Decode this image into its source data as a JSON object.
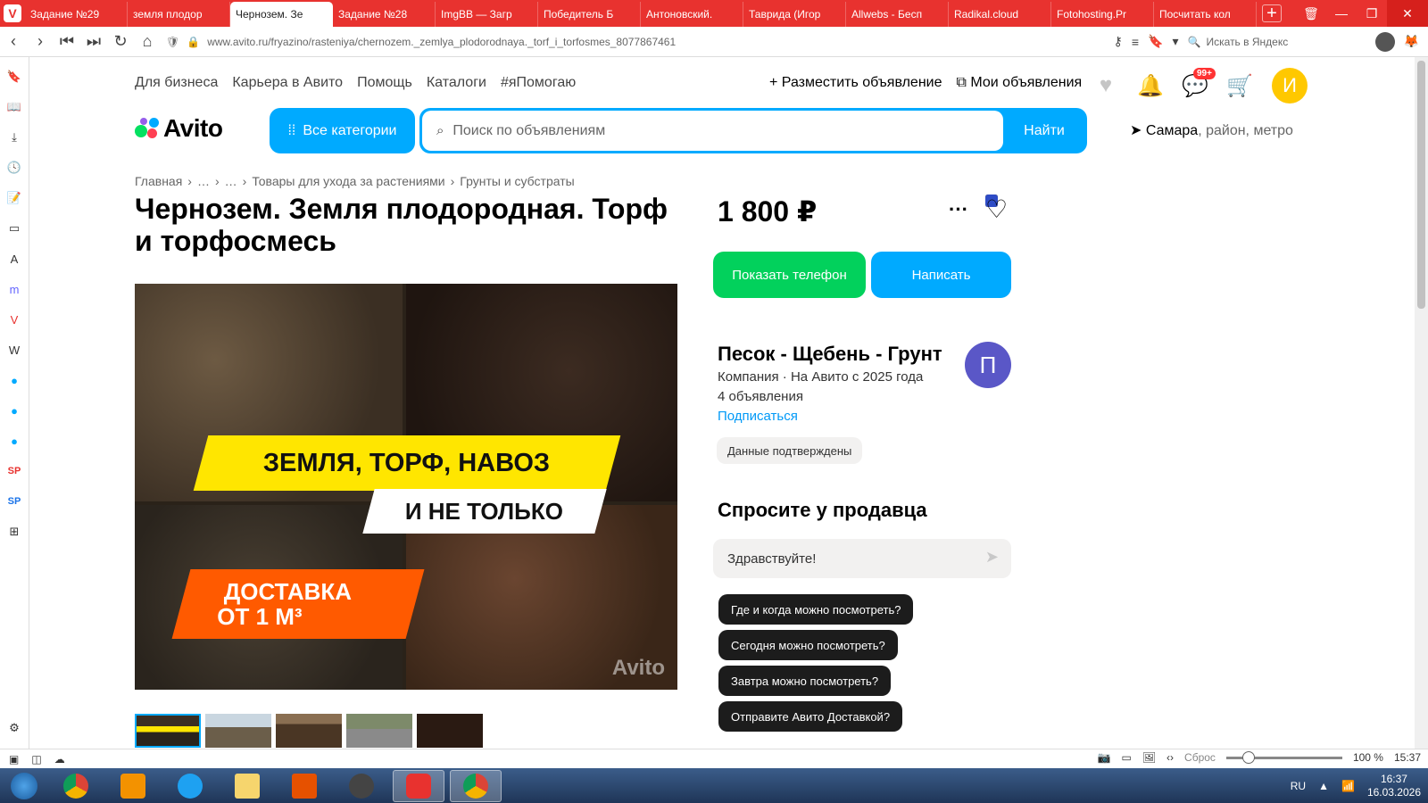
{
  "browser": {
    "tabs": [
      {
        "title": "Задание №29",
        "favicon_color": "#e8322f",
        "favicon_text": "SP"
      },
      {
        "title": "земля плодор",
        "favicon_color": "#ffffff",
        "favicon_text": ""
      },
      {
        "title": "Чернозем. Зе",
        "favicon_color": "#00aaff",
        "favicon_text": "",
        "active": true
      },
      {
        "title": "Задание №28",
        "favicon_color": "#e8322f",
        "favicon_text": "SP"
      },
      {
        "title": "ImgBB — Загр",
        "favicon_color": "#2a7ae2",
        "favicon_text": "ibb"
      },
      {
        "title": "Победитель Б",
        "favicon_color": "#0077ff",
        "favicon_text": "VK"
      },
      {
        "title": "Антоновский.",
        "favicon_color": "#7a3d8f",
        "favicon_text": "LIB"
      },
      {
        "title": "Таврида (Игор",
        "favicon_color": "#3fae49",
        "favicon_text": ""
      },
      {
        "title": "Allwebs - Бесп",
        "favicon_color": "#1aa3c8",
        "favicon_text": ""
      },
      {
        "title": "Radikal.cloud",
        "favicon_color": "#111111",
        "favicon_text": "R"
      },
      {
        "title": "Fotohosting.Pr",
        "favicon_color": "#f5a623",
        "favicon_text": "F"
      },
      {
        "title": "Посчитать кол",
        "favicon_color": "#2e4cc6",
        "favicon_text": ""
      }
    ],
    "url": "www.avito.ru/fryazino/rasteniya/chernozem._zemlya_plodorodnaya._torf_i_torfosmes_8077867461",
    "yandex_placeholder": "Искать в Яндекс",
    "accent": "#e8322f"
  },
  "header": {
    "nav": [
      "Для бизнеса",
      "Карьера в Авито",
      "Помощь",
      "Каталоги",
      "#яПомогаю"
    ],
    "post_ad": "Разместить объявление",
    "my_ads": "Мои объявления",
    "messages_badge": "99+",
    "user_initial": "И",
    "logo": "Avito",
    "all_categories": "Все категории",
    "search_placeholder": "Поиск по объявлениям",
    "search_button": "Найти",
    "location_city": "Самара",
    "location_rest": ", район, метро"
  },
  "breadcrumbs": [
    "Главная",
    "…",
    "…",
    "Товары для ухода за растениями",
    "Грунты и субстраты"
  ],
  "listing": {
    "title": "Чернозем. Земля плодородная. Торф и торфосмесь",
    "price": "1 800 ₽",
    "image_text": {
      "line1": "ЗЕМЛЯ, ТОРФ, НАВОЗ",
      "line2": "И НЕ ТОЛЬКО",
      "line3": "ДОСТАВКА",
      "line4": "ОТ 1 М³",
      "watermark": "Avito"
    },
    "thumbnails_count": 5
  },
  "actions": {
    "show_phone": "Показать телефон",
    "write": "Написать"
  },
  "seller": {
    "name": "Песок - Щебень - Грунт",
    "info": "Компания · На Авито с 2025 года",
    "ads_count": "4 объявления",
    "subscribe": "Подписаться",
    "avatar_initial": "П",
    "verified": "Данные подтверждены"
  },
  "ask": {
    "title": "Спросите у продавца",
    "input_value": "Здравствуйте!",
    "chips": [
      "Где и когда можно посмотреть?",
      "Сегодня можно посмотреть?",
      "Завтра можно посмотреть?",
      "Отправите Авито Доставкой?"
    ]
  },
  "statusbar": {
    "reset": "Сброс",
    "zoom": "100 %",
    "time": "15:37"
  },
  "taskbar": {
    "lang": "RU",
    "time": "16:37",
    "date": "16.03.2026"
  }
}
